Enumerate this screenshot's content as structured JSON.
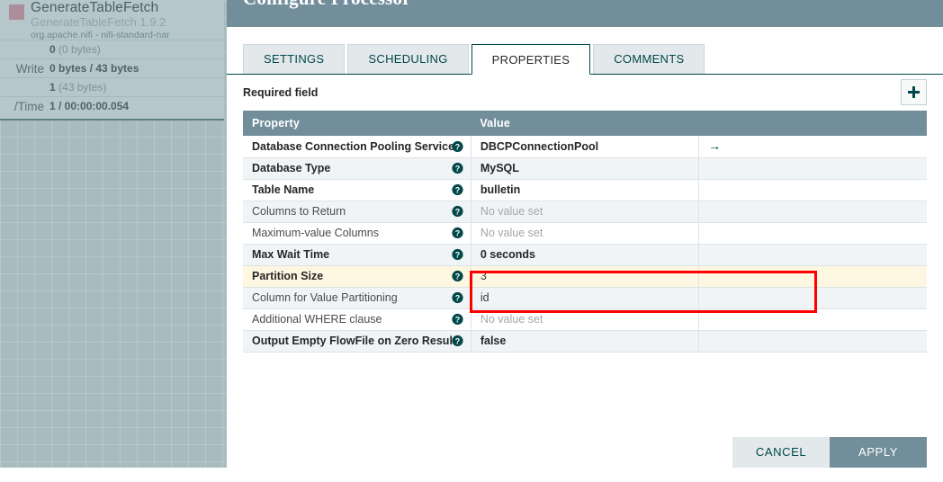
{
  "canvas": {
    "processor": {
      "name": "GenerateTableFetch",
      "type_version": "GenerateTableFetch 1.9.2",
      "bundle": "org.apache.nifi - nifi-standard-nar",
      "stats": [
        {
          "label": "",
          "value_bold": "0",
          "value_muted": "(0 bytes)"
        },
        {
          "label": "Write",
          "value_bold": "0 bytes / 43 bytes",
          "value_muted": ""
        },
        {
          "label": "",
          "value_bold": "1",
          "value_muted": "(43 bytes)"
        },
        {
          "label": "/Time",
          "value_bold": "1 / 00:00:00.054",
          "value_muted": ""
        }
      ]
    }
  },
  "dialog": {
    "title": "Configure Processor",
    "tabs": [
      {
        "label": "SETTINGS",
        "active": false
      },
      {
        "label": "SCHEDULING",
        "active": false
      },
      {
        "label": "PROPERTIES",
        "active": true
      },
      {
        "label": "COMMENTS",
        "active": false
      }
    ],
    "required_field_legend": "Required field",
    "add_property_label": "+",
    "table": {
      "headers": [
        "Property",
        "Value"
      ],
      "rows": [
        {
          "property": "Database Connection Pooling Service",
          "required": true,
          "value": "DBCPConnectionPool",
          "value_state": "set",
          "action": "→",
          "highlighted": false
        },
        {
          "property": "Database Type",
          "required": true,
          "value": "MySQL",
          "value_state": "set",
          "action": "",
          "highlighted": false
        },
        {
          "property": "Table Name",
          "required": true,
          "value": "bulletin",
          "value_state": "set",
          "action": "",
          "highlighted": false
        },
        {
          "property": "Columns to Return",
          "required": false,
          "value": "No value set",
          "value_state": "unset",
          "action": "",
          "highlighted": false
        },
        {
          "property": "Maximum-value Columns",
          "required": false,
          "value": "No value set",
          "value_state": "unset",
          "action": "",
          "highlighted": false
        },
        {
          "property": "Max Wait Time",
          "required": true,
          "value": "0 seconds",
          "value_state": "set",
          "action": "",
          "highlighted": false
        },
        {
          "property": "Partition Size",
          "required": true,
          "value": "3",
          "value_state": "plain",
          "action": "",
          "highlighted": true
        },
        {
          "property": "Column for Value Partitioning",
          "required": false,
          "value": "id",
          "value_state": "plain",
          "action": "",
          "highlighted": false
        },
        {
          "property": "Additional WHERE clause",
          "required": false,
          "value": "No value set",
          "value_state": "unset",
          "action": "",
          "highlighted": false
        },
        {
          "property": "Output Empty FlowFile on Zero Results",
          "required": true,
          "value": "false",
          "value_state": "set",
          "action": "",
          "highlighted": false
        }
      ]
    },
    "footer": {
      "cancel_label": "CANCEL",
      "apply_label": "APPLY"
    }
  },
  "colors": {
    "header_slate": "#728e9b",
    "accent_teal": "#004849",
    "annotation_red": "#ff0000",
    "highlight_row": "#fdf7e2",
    "canvas_bg": "#a8bcc0"
  }
}
